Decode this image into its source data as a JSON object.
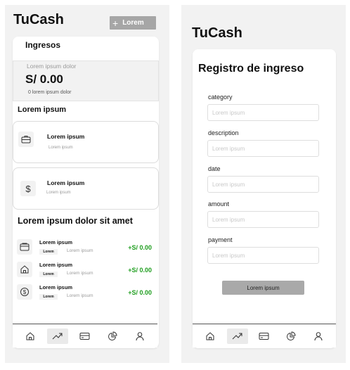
{
  "left": {
    "app_title": "TuCash",
    "add_button_label": "Lorem",
    "section_title": "Ingresos",
    "balance": {
      "caption": "Lorem ipsum dolor",
      "amount": "S/ 0.00",
      "footnote": "0 lorem ipsum dolor"
    },
    "categories_title": "Lorem ipsum",
    "categories": [
      {
        "icon": "briefcase-icon",
        "title": "Lorem ipsum",
        "subtitle": "Lorem ipsum"
      },
      {
        "icon": "dollar-icon",
        "title": "Lorem ipsum",
        "subtitle": "Lorem ipsum"
      }
    ],
    "transactions_title": "Lorem ipsum dolor sit amet",
    "transactions": [
      {
        "icon": "wallet-icon",
        "title": "Lorem ipsum",
        "badge": "Lorem",
        "subtitle": "Lorem ipsum",
        "amount": "+S/ 0.00"
      },
      {
        "icon": "home-icon",
        "title": "Lorem ipsum",
        "badge": "Lorem",
        "subtitle": "Lorem ipsum",
        "amount": "+S/ 0.00"
      },
      {
        "icon": "coin-icon",
        "title": "Lorem ipsum",
        "badge": "Lorem",
        "subtitle": "Lorem ipsum",
        "amount": "+S/ 0.00"
      }
    ]
  },
  "right": {
    "app_title": "TuCash",
    "form_title": "Registro de ingreso",
    "fields": [
      {
        "label": "category",
        "placeholder": "Lorem ipsum"
      },
      {
        "label": "description",
        "placeholder": "Lorem ipsum"
      },
      {
        "label": "date",
        "placeholder": "Lorem ipsum"
      },
      {
        "label": "amount",
        "placeholder": "Lorem ipsum"
      },
      {
        "label": "payment",
        "placeholder": "Lorem ipsum"
      }
    ],
    "submit_label": "Lorem ipsum"
  },
  "nav": {
    "items": [
      "home-icon",
      "trending-icon",
      "card-icon",
      "chart-icon",
      "user-icon"
    ],
    "active": "trending-icon"
  },
  "colors": {
    "panel_bg": "#f2f2f2",
    "button_gray": "#a6a6a6",
    "positive_green": "#1f9e1f"
  }
}
